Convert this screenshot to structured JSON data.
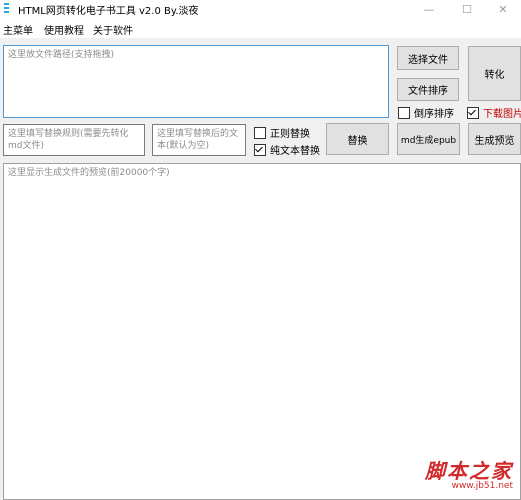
{
  "window": {
    "title": "HTML网页转化电子书工具 v2.0 By.淡夜",
    "controls": {
      "minimize": "—",
      "maximize": "☐",
      "close": "✕"
    }
  },
  "menu": {
    "items": [
      "主菜单",
      "使用教程",
      "关于软件"
    ]
  },
  "file_path_input": {
    "placeholder": "这里放文件路径(支持拖拽)"
  },
  "buttons": {
    "select_file": "选择文件",
    "sort_files": "文件排序",
    "convert": "转化",
    "replace": "替换",
    "md_epub": "md生成epub",
    "preview": "生成预览"
  },
  "checkboxes": {
    "reverse_sort": {
      "label": "倒序排序",
      "checked": false
    },
    "download_images": {
      "label": "下载图片",
      "checked": true,
      "color": "#c00000"
    },
    "regex_replace": {
      "label": "正则替换",
      "checked": false
    },
    "plain_text_replace": {
      "label": "纯文本替换",
      "checked": true
    }
  },
  "rule_input": {
    "placeholder": "这里填写替换规则(需要先转化md文件)"
  },
  "replacement_input": {
    "placeholder": "这里填写替换后的文本(默认为空)"
  },
  "preview_area": {
    "placeholder": "这里显示生成文件的预览(前20000个字)"
  },
  "watermark": {
    "main": "脚本之家",
    "url": "www.jb51.net"
  },
  "colors": {
    "accent_focus": "#4f9bd9",
    "window_bg": "#f0f0f0",
    "watermark": "#d12a2a"
  }
}
